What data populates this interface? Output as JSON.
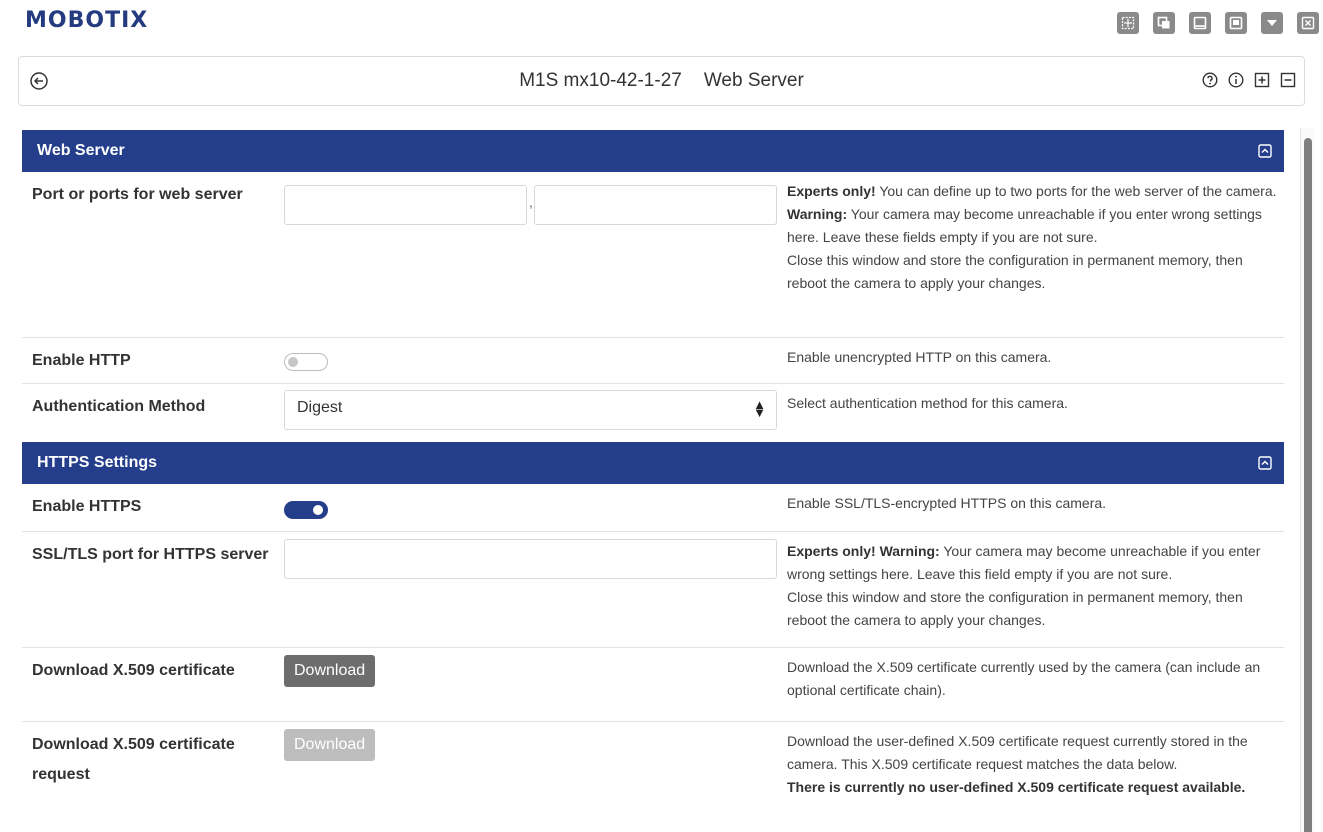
{
  "app": {
    "logo": "MOBOTIX"
  },
  "window_tools": [
    {
      "icon": "grid-view-icon"
    },
    {
      "icon": "copy-window-icon"
    },
    {
      "icon": "window-icon"
    },
    {
      "icon": "save-icon"
    },
    {
      "icon": "dropdown-icon"
    },
    {
      "icon": "close-icon"
    }
  ],
  "titlebar": {
    "camera": "M1S mx10-42-1-27",
    "page": "Web Server"
  },
  "sections": {
    "web_server": {
      "title": "Web Server",
      "rows": {
        "ports": {
          "label": "Port or ports for web server",
          "port1": "",
          "port2": "",
          "separator": ",",
          "help_expert": "Experts only!",
          "help_1": " You can define up to two ports for the web server of the camera.",
          "help_warning": "Warning:",
          "help_2": " Your camera may become unreachable if you enter wrong settings here. Leave these fields empty if you are not sure.",
          "help_3": "Close this window and store the configuration in permanent memory, then reboot the camera to apply your changes."
        },
        "http": {
          "label": "Enable HTTP",
          "enabled": false,
          "help": "Enable unencrypted HTTP on this camera."
        },
        "auth": {
          "label": "Authentication Method",
          "value": "Digest",
          "help": "Select authentication method for this camera."
        }
      }
    },
    "https": {
      "title": "HTTPS Settings",
      "rows": {
        "https_enable": {
          "label": "Enable HTTPS",
          "enabled": true,
          "help": "Enable SSL/TLS-encrypted HTTPS on this camera."
        },
        "ssl_port": {
          "label": "SSL/TLS port for HTTPS server",
          "value": "",
          "help_bold": "Experts only! Warning:",
          "help_1": " Your camera may become unreachable if you enter wrong settings here. Leave this field empty if you are not sure.",
          "help_2": "Close this window and store the configuration in permanent memory, then reboot the camera to apply your changes."
        },
        "cert": {
          "label": "Download X.509 certificate",
          "button": "Download",
          "help": "Download the X.509 certificate currently used by the camera (can include an optional certificate chain)."
        },
        "cert_req": {
          "label": "Download X.509 certificate request",
          "button": "Download",
          "help_1": "Download the user-defined X.509 certificate request currently stored in the camera. This X.509 certificate request matches the data below.",
          "help_bold": "There is currently no user-defined X.509 certificate request available."
        }
      }
    }
  },
  "colors": {
    "brand": "#243b80",
    "section_header": "#243e8c",
    "button_dark": "#6d6d6d",
    "button_disabled": "#bdbdbd"
  }
}
